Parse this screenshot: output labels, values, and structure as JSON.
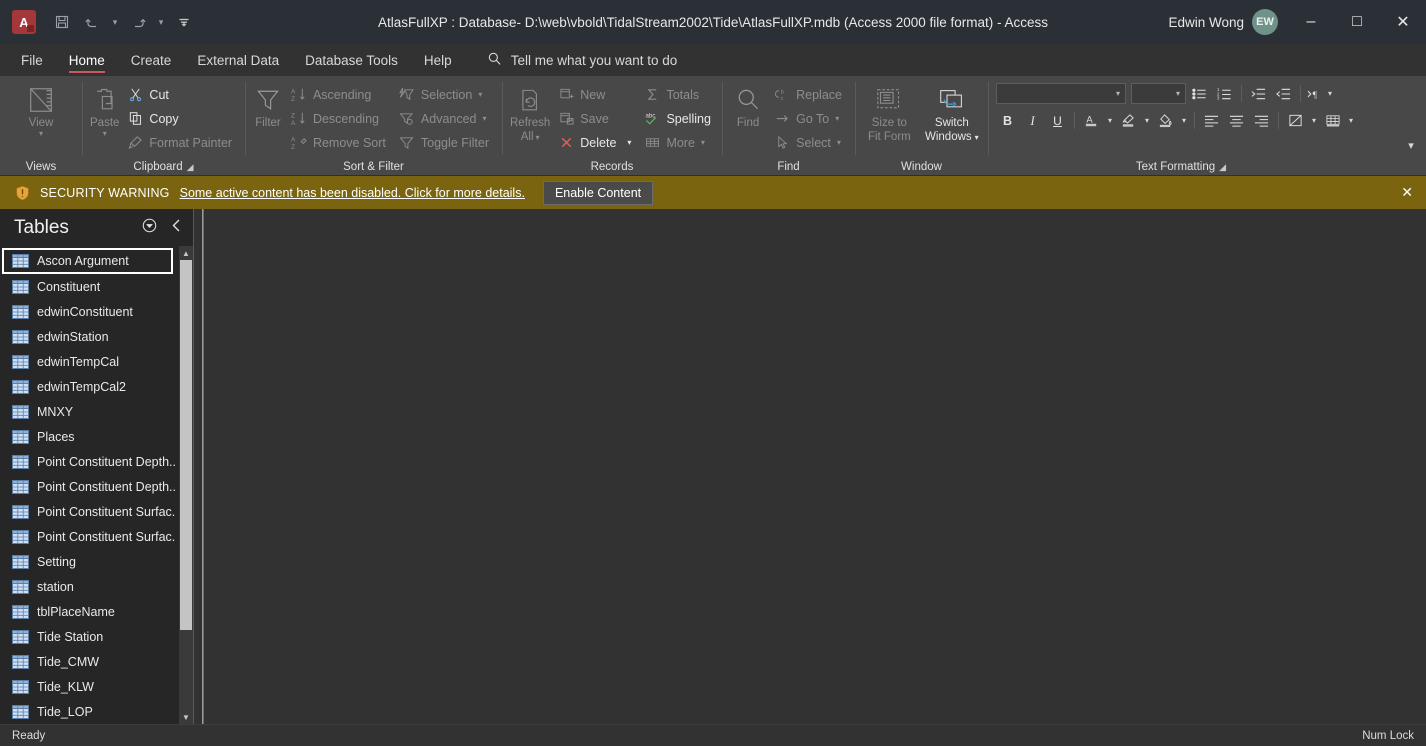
{
  "titlebar": {
    "app_icon": "access-app-icon",
    "app_letter": "A",
    "title": "AtlasFullXP : Database- D:\\web\\vbold\\TidalStream2002\\Tide\\AtlasFullXP.mdb (Access 2000 file format)  -  Access",
    "user_name": "Edwin Wong",
    "avatar_initials": "EW",
    "qat": [
      {
        "name": "save-icon",
        "label": "Save"
      },
      {
        "name": "undo-icon",
        "label": "Undo"
      },
      {
        "name": "redo-icon",
        "label": "Redo"
      },
      {
        "name": "customize-quick-access-toolbar-icon",
        "label": "Customize Quick Access Toolbar"
      }
    ],
    "window_buttons": [
      {
        "name": "minimize-button",
        "glyph": "–"
      },
      {
        "name": "maximize-button",
        "glyph": "□"
      },
      {
        "name": "close-button",
        "glyph": "✕"
      }
    ]
  },
  "tabs": [
    {
      "label": "File",
      "active": false
    },
    {
      "label": "Home",
      "active": true
    },
    {
      "label": "Create",
      "active": false
    },
    {
      "label": "External Data",
      "active": false
    },
    {
      "label": "Database Tools",
      "active": false
    },
    {
      "label": "Help",
      "active": false
    }
  ],
  "tellme": {
    "placeholder": "Tell me what you want to do",
    "icon": "search-icon"
  },
  "ribbon": {
    "groups": [
      {
        "label": "Views",
        "has_launcher": false
      },
      {
        "label": "Clipboard",
        "has_launcher": true
      },
      {
        "label": "Sort & Filter",
        "has_launcher": false
      },
      {
        "label": "Records",
        "has_launcher": false
      },
      {
        "label": "Find",
        "has_launcher": false
      },
      {
        "label": "Window",
        "has_launcher": false
      },
      {
        "label": "Text Formatting",
        "has_launcher": true
      }
    ],
    "views": {
      "view_label": "View",
      "disabled": true
    },
    "clipboard": {
      "paste_label": "Paste",
      "paste_disabled": true,
      "cut_label": "Cut",
      "copy_label": "Copy",
      "format_painter_label": "Format Painter",
      "format_painter_disabled": true
    },
    "sortfilter": {
      "filter_label": "Filter",
      "ascending_label": "Ascending",
      "descending_label": "Descending",
      "remove_sort_label": "Remove Sort",
      "selection_label": "Selection",
      "advanced_label": "Advanced",
      "toggle_filter_label": "Toggle Filter"
    },
    "records": {
      "refresh_label_line1": "Refresh",
      "refresh_label_line2": "All",
      "new_label": "New",
      "save_label": "Save",
      "delete_label": "Delete",
      "totals_label": "Totals",
      "spelling_label": "Spelling",
      "more_label": "More"
    },
    "find": {
      "find_label": "Find",
      "replace_label": "Replace",
      "goto_label": "Go To",
      "select_label": "Select"
    },
    "window": {
      "size_to_fit_line1": "Size to",
      "size_to_fit_line2": "Fit Form",
      "switch_windows_line1": "Switch",
      "switch_windows_line2": "Windows"
    },
    "text_formatting": {
      "font_value": "",
      "font_size_value": "",
      "bold": "B",
      "italic": "I",
      "underline": "U",
      "font_color": "A",
      "buttons": [
        "bulleted-list",
        "numbered-list",
        "decrease-indent",
        "increase-indent",
        "text-direction",
        "align-left",
        "align-center",
        "align-right",
        "alternate-row-color",
        "gridlines"
      ]
    },
    "collapse_icon": "chevron-down-icon"
  },
  "security_bar": {
    "icon": "shield-warning-icon",
    "title": "SECURITY WARNING",
    "message": "Some active content has been disabled. Click for more details.",
    "button": "Enable Content",
    "close_glyph": "✕",
    "bg_color": "#7b6410"
  },
  "nav_pane": {
    "title": "Tables",
    "menu_icon": "circled-chevron-down-icon",
    "collapse_icon": "chevron-left-icon",
    "items": [
      {
        "label": "Ascon Argument",
        "focused": true
      },
      {
        "label": "Constituent",
        "focused": false
      },
      {
        "label": "edwinConstituent",
        "focused": false
      },
      {
        "label": "edwinStation",
        "focused": false
      },
      {
        "label": "edwinTempCal",
        "focused": false
      },
      {
        "label": "edwinTempCal2",
        "focused": false
      },
      {
        "label": "MNXY",
        "focused": false
      },
      {
        "label": "Places",
        "focused": false
      },
      {
        "label": "Point Constituent Depth...",
        "focused": false
      },
      {
        "label": "Point Constituent Depth...",
        "focused": false
      },
      {
        "label": "Point Constituent Surfac...",
        "focused": false
      },
      {
        "label": "Point Constituent Surfac...",
        "focused": false
      },
      {
        "label": "Setting",
        "focused": false
      },
      {
        "label": "station",
        "focused": false
      },
      {
        "label": "tblPlaceName",
        "focused": false
      },
      {
        "label": "Tide Station",
        "focused": false
      },
      {
        "label": "Tide_CMW",
        "focused": false
      },
      {
        "label": "Tide_KLW",
        "focused": false
      },
      {
        "label": "Tide_LOP",
        "focused": false
      }
    ],
    "scroll_up_glyph": "▲",
    "scroll_down_glyph": "▼"
  },
  "status_bar": {
    "left": "Ready",
    "right": "Num Lock"
  }
}
